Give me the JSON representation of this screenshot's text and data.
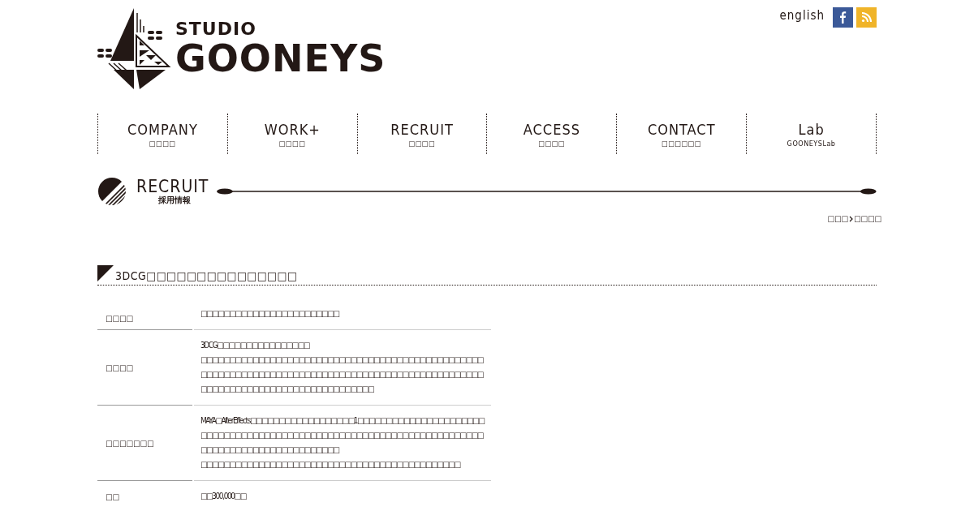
{
  "logo": {
    "small": "STUDIO",
    "large": "GOONEYS"
  },
  "header_links": {
    "language": "english"
  },
  "nav": [
    {
      "label": "COMPANY",
      "sub": "□□□□",
      "selected": false
    },
    {
      "label": "WORK+",
      "sub": "□□□□",
      "selected": false
    },
    {
      "label": "RECRUIT",
      "sub": "□□□□",
      "selected": false
    },
    {
      "label": "ACCESS",
      "sub": "□□□□",
      "selected": false
    },
    {
      "label": "CONTACT",
      "sub": "□□□□□□",
      "selected": false
    },
    {
      "label": "Lab",
      "sub": "GOONEYSLab",
      "selected": false
    }
  ],
  "page_title": {
    "title": "RECRUIT",
    "subtitle": "採用情報"
  },
  "breadcrumb": [
    "□□□",
    "□□□□"
  ],
  "section_heading": "3DCG□□□□□□□□□□□□□□□",
  "table": [
    {
      "label": "□□□□",
      "lines": [
        "□□□□□□□□□□□□□□□□□□□□□□□□"
      ]
    },
    {
      "label": "□□□□",
      "lines": [
        "3DCG□□□□□□□□□□□□□□□□",
        "□□□□□□□□□□□□□□□□□□□□□□□□□□□□□□□□□□□□□□□□□□□□□□□□□□□□□□□□□□□□□□□□□□□□□□□□□□□□□□□□□□□□□□□□□□□□□□□□□□□□□□□□□□□□□□□□□□□□□□□□□□□□□□□□"
      ]
    },
    {
      "label": "□□□□□□□",
      "lines": [
        "MAYA□AfterEffects□□□□□□□□□□□□□□□□□□1□□□□□□□□□□□□□□□□□□□□□□□□□□□□□□□□□□□□□□□□□□□□□□□□□□□□□□□□□□□□□□□□□□□□□□□□□□□□□□□□□□□□□□□□□□□□□□□",
        "□□□□□□□□□□□□□□□□□□□□□□□□□□□□□□□□□□□□□□□□□□□□□"
      ]
    },
    {
      "label": "□□",
      "lines": [
        "□□300,000□□"
      ]
    }
  ]
}
